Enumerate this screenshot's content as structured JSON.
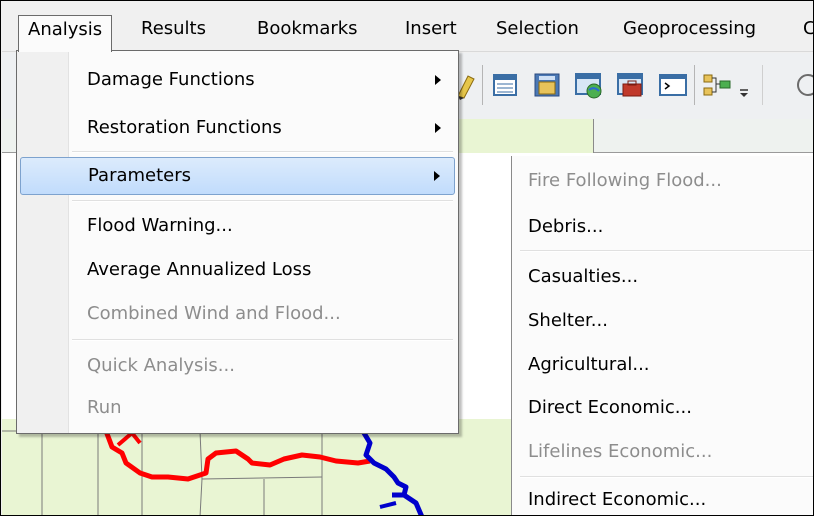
{
  "menubar": {
    "items": [
      "Analysis",
      "Results",
      "Bookmarks",
      "Insert",
      "Selection",
      "Geoprocessing",
      "C"
    ],
    "active": "Analysis"
  },
  "toolbar": {
    "icons": [
      "pencil-icon",
      "attribute-table-icon",
      "catalog-icon",
      "globe-window-icon",
      "toolbox-icon",
      "python-window-icon",
      "model-builder-icon",
      "toolbar-options-icon"
    ]
  },
  "analysis_menu": {
    "items": [
      {
        "label": "Damage Functions",
        "submenu": true,
        "enabled": true
      },
      {
        "label": "Restoration Functions",
        "submenu": true,
        "enabled": true
      },
      {
        "label": "Parameters",
        "submenu": true,
        "enabled": true,
        "highlighted": true
      },
      {
        "label": "Flood Warning...",
        "submenu": false,
        "enabled": true
      },
      {
        "label": "Average Annualized Loss",
        "submenu": false,
        "enabled": true
      },
      {
        "label": "Combined Wind and Flood...",
        "submenu": false,
        "enabled": false
      },
      {
        "label": "Quick Analysis...",
        "submenu": false,
        "enabled": false
      },
      {
        "label": "Run",
        "submenu": false,
        "enabled": false
      }
    ]
  },
  "parameters_submenu": {
    "items": [
      {
        "label": "Fire Following Flood...",
        "enabled": false
      },
      {
        "label": "Debris...",
        "enabled": true
      },
      {
        "label": "Casualties...",
        "enabled": true
      },
      {
        "label": "Shelter...",
        "enabled": true
      },
      {
        "label": "Agricultural...",
        "enabled": true
      },
      {
        "label": "Direct Economic...",
        "enabled": true
      },
      {
        "label": "Lifelines Economic...",
        "enabled": false
      },
      {
        "label": "Indirect Economic...",
        "enabled": true
      }
    ]
  },
  "colors": {
    "highlight": "#c1dcfc",
    "disabled_text": "#8d8d8d",
    "map_fill": "#e9f5d3",
    "river_red": "#ff0000",
    "river_blue": "#0000cc"
  }
}
